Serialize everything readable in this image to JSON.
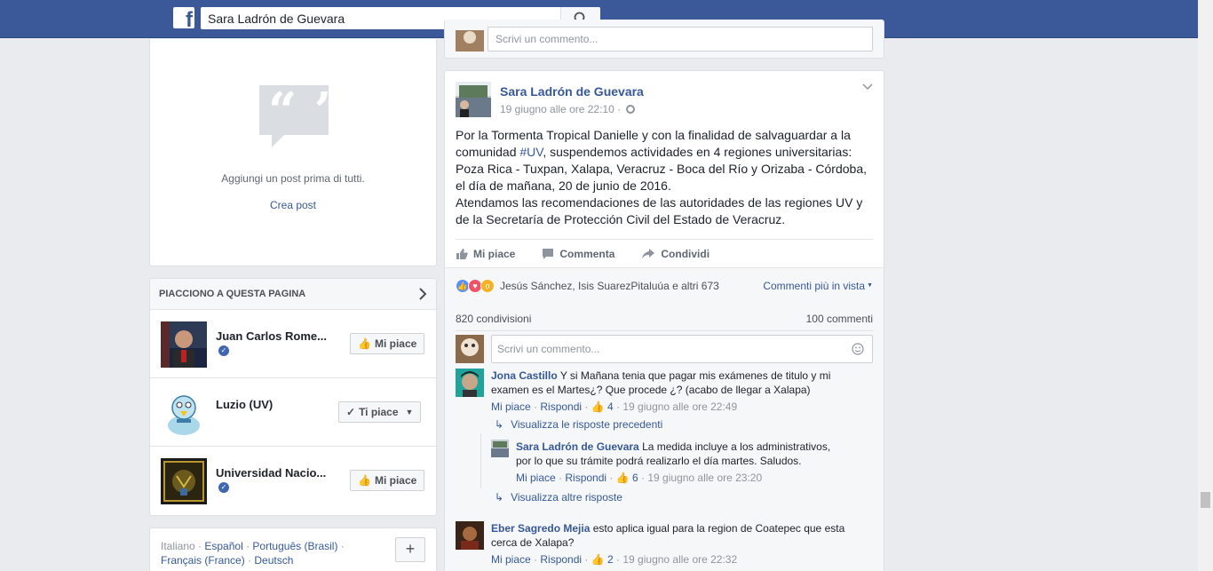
{
  "topbar": {
    "search_value": "Sara Ladrón de Guevara",
    "logo_letter": "f"
  },
  "left": {
    "add_post_text": "Aggiungi un post prima di tutti.",
    "create_post": "Crea post",
    "likes_header": "PIACCIONO A QUESTA PAGINA",
    "pages": [
      {
        "name": "Juan Carlos Rome...",
        "button": "Mi piace",
        "verified": true
      },
      {
        "name": "Luzio (UV)",
        "button": "Ti piace",
        "verified": false
      },
      {
        "name": "Universidad Nacio...",
        "button": "Mi piace",
        "verified": true
      }
    ],
    "languages": {
      "current": "Italiano",
      "sep": " · ",
      "links": [
        "Español",
        "Português (Brasil)",
        "Français (France)",
        "Deutsch"
      ]
    },
    "plus": "+"
  },
  "prev_post": {
    "comment_placeholder": "Scrivi un commento..."
  },
  "post": {
    "author": "Sara Ladrón de Guevara",
    "date": "19 giugno alle ore 22:10 ·",
    "text_1": "Por la Tormenta Tropical Danielle y con la finalidad de salvaguardar a la comunidad ",
    "hashtag": "#UV",
    "text_2": ", suspendemos actividades en 4 regiones universitarias: Poza Rica - Tuxpan, Xalapa, Veracruz - Boca del Río y Orizaba - Córdoba, el día de mañana, 20 de junio de 2016.",
    "text_3": "Atendamos las recomendaciones de las autoridades de las regiones UV y de la Secretaría de Protección Civil del Estado de Veracruz.",
    "actions": {
      "like": "Mi piace",
      "comment": "Commenta",
      "share": "Condividi"
    },
    "reactions_names": "Jesús Sánchez, Isis SuarezPitaluúa e altri 673",
    "most_relevant": "Commenti più in vista",
    "shares": "820 condivisioni",
    "comments_count": "100 commenti",
    "comment_placeholder": "Scrivi un commento..."
  },
  "comments": [
    {
      "author": "Jona Castillo",
      "text": "Y si Mañana tenia que pagar mis exámenes de titulo y mi examen es el Martes¿? Que procede ¿? (acabo de llegar a Xalapa)",
      "like": "Mi piace",
      "reply": "Rispondi",
      "likes": "4",
      "time": "19 giugno alle ore 22:49",
      "prev_replies": "Visualizza le risposte precedenti"
    },
    {
      "author": "Sara Ladrón de Guevara",
      "text": "La medida incluye a los administrativos, por lo que su trámite podrá realizarlo el día martes. Saludos.",
      "like": "Mi piace",
      "reply": "Rispondi",
      "likes": "6",
      "time": "19 giugno alle ore 23:20",
      "more_replies": "Visualizza altre risposte"
    },
    {
      "author": "Eber Sagredo Mejia",
      "text": "esto aplica igual para la region de Coatepec que esta cerca de Xalapa?",
      "like": "Mi piace",
      "reply": "Rispondi",
      "likes": "2",
      "time": "19 giugno alle ore 22:32"
    }
  ],
  "colors": {
    "topbar": "#3b5998",
    "link": "#365899",
    "background": "#e9ebee"
  }
}
